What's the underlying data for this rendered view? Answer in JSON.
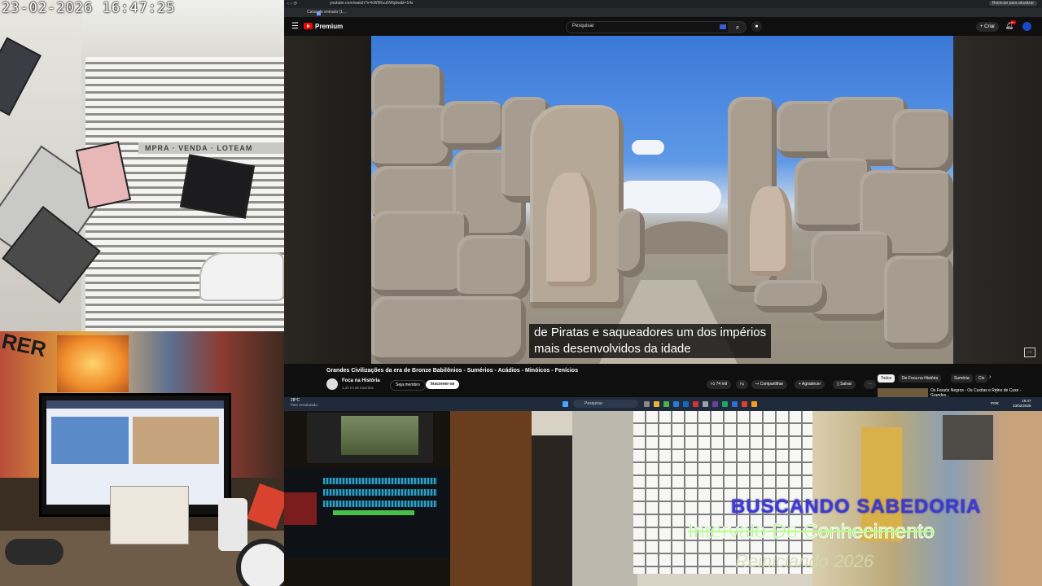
{
  "cameras": {
    "gate_osd": "23-02-2026 16:47:25",
    "gate_sign": "MPRA · VENDA · LOTEAM",
    "desk_mural_text": "RER"
  },
  "browser": {
    "url": "youtube.com/watch?v=kW5Rcu5Wqbw&t=14s",
    "bookmark": "Caixa de entrada (1...",
    "restart_label": "Reiniciar para atualizar",
    "brand": "Premium",
    "search_placeholder": "Pesquisar",
    "create_label": "+ Criar",
    "notif_count": "9+"
  },
  "video": {
    "caption_line1": "de Piratas e saqueadores um dos impérios",
    "caption_line2": "mais desenvolvidos da idade",
    "title": "Grandes Civilizações da era de Bronze Babilônios - Sumérios - Acádios - Minóicos - Fenícios",
    "channel": "Foca na História",
    "subscribers": "1,41 mi de inscritos",
    "join_label": "Seja membro",
    "subscribe_label": "Inscrever-se",
    "likes": "74 mil",
    "share_label": "Compartilhar",
    "thanks_label": "Agradecer",
    "save_label": "Salvar",
    "chips": [
      "Todos",
      "De Foca na História",
      "Suméria",
      "Civ"
    ],
    "reco_title": "Os Faraós Negros - Os Cuxitas e Reino de Cuxe - Grandes..."
  },
  "taskbar": {
    "weather_temp": "28°C",
    "weather_desc": "Parc ensolarado",
    "search_label": "Pesquisar",
    "lang": "POR",
    "time": "16:47",
    "date": "23/02/2026"
  },
  "overlay": {
    "line1": "BUSCANDO SABEDORIA",
    "line2": "Intervalo Do Conhecimento",
    "line3": "Reiniciando 2026"
  },
  "colors": {
    "youtube_red": "#ff0000",
    "overlay_blue": "#3d3ad6",
    "overlay_green": "#9bf56d"
  }
}
